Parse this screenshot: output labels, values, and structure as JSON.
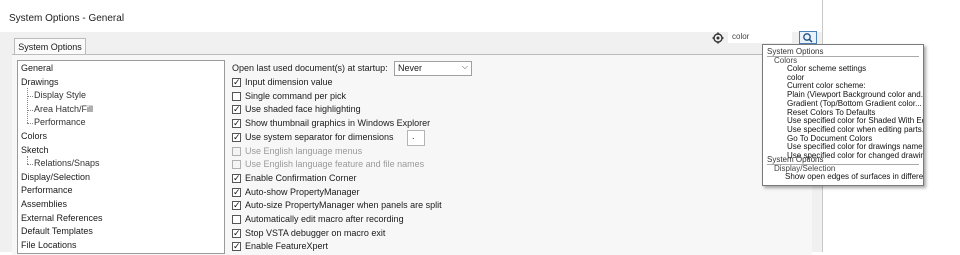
{
  "window": {
    "title": "System Options - General",
    "tab_label": "System Options"
  },
  "tree": {
    "items": [
      {
        "label": "General",
        "level": 0
      },
      {
        "label": "Drawings",
        "level": 0
      },
      {
        "label": "Display Style",
        "level": 1
      },
      {
        "label": "Area Hatch/Fill",
        "level": 1
      },
      {
        "label": "Performance",
        "level": 1
      },
      {
        "label": "Colors",
        "level": 0
      },
      {
        "label": "Sketch",
        "level": 0
      },
      {
        "label": "Relations/Snaps",
        "level": 1
      },
      {
        "label": "Display/Selection",
        "level": 0
      },
      {
        "label": "Performance",
        "level": 0
      },
      {
        "label": "Assemblies",
        "level": 0
      },
      {
        "label": "External References",
        "level": 0
      },
      {
        "label": "Default Templates",
        "level": 0
      },
      {
        "label": "File Locations",
        "level": 0
      }
    ]
  },
  "options": {
    "open_last_label": "Open last used document(s) at startup:",
    "open_last_value": "Never",
    "separator_value": ".",
    "checkboxes": [
      {
        "label": "Input dimension value",
        "checked": true,
        "enabled": true
      },
      {
        "label": "Single command per pick",
        "checked": false,
        "enabled": true
      },
      {
        "label": "Use shaded face highlighting",
        "checked": true,
        "enabled": true
      },
      {
        "label": "Show thumbnail graphics in Windows Explorer",
        "checked": true,
        "enabled": true
      },
      {
        "label": "Use system separator for dimensions",
        "checked": true,
        "enabled": true
      },
      {
        "label": "Use English language menus",
        "checked": false,
        "enabled": false
      },
      {
        "label": "Use English language feature and file names",
        "checked": false,
        "enabled": false
      },
      {
        "label": "Enable Confirmation Corner",
        "checked": true,
        "enabled": true
      },
      {
        "label": "Auto-show PropertyManager",
        "checked": true,
        "enabled": true
      },
      {
        "label": "Auto-size PropertyManager when panels are split",
        "checked": true,
        "enabled": true
      },
      {
        "label": "Automatically edit macro after recording",
        "checked": false,
        "enabled": true
      },
      {
        "label": "Stop VSTA debugger on macro exit",
        "checked": true,
        "enabled": true
      },
      {
        "label": "Enable FeatureXpert",
        "checked": true,
        "enabled": true
      }
    ]
  },
  "search": {
    "value": "color",
    "icons": [
      "gear-icon",
      "search-icon"
    ]
  },
  "dropdown": {
    "group1_header": "System Options",
    "group1_sub": "Colors",
    "group1_items": [
      "Color scheme settings",
      "color",
      "Current color scheme:",
      "Plain (Viewport Background color and...",
      "Gradient (Top/Bottom Gradient color...",
      "Reset Colors To Defaults",
      "Use specified color for Shaded With Edges...",
      "Use specified color when editing parts...",
      "Go To Document Colors",
      "Use specified color for drawings name...",
      "Use specified color for changed drawings..."
    ],
    "group2_header": "System Options",
    "group2_sub": "Display/Selection",
    "group2_items": [
      "Show open edges of surfaces in different color"
    ]
  }
}
